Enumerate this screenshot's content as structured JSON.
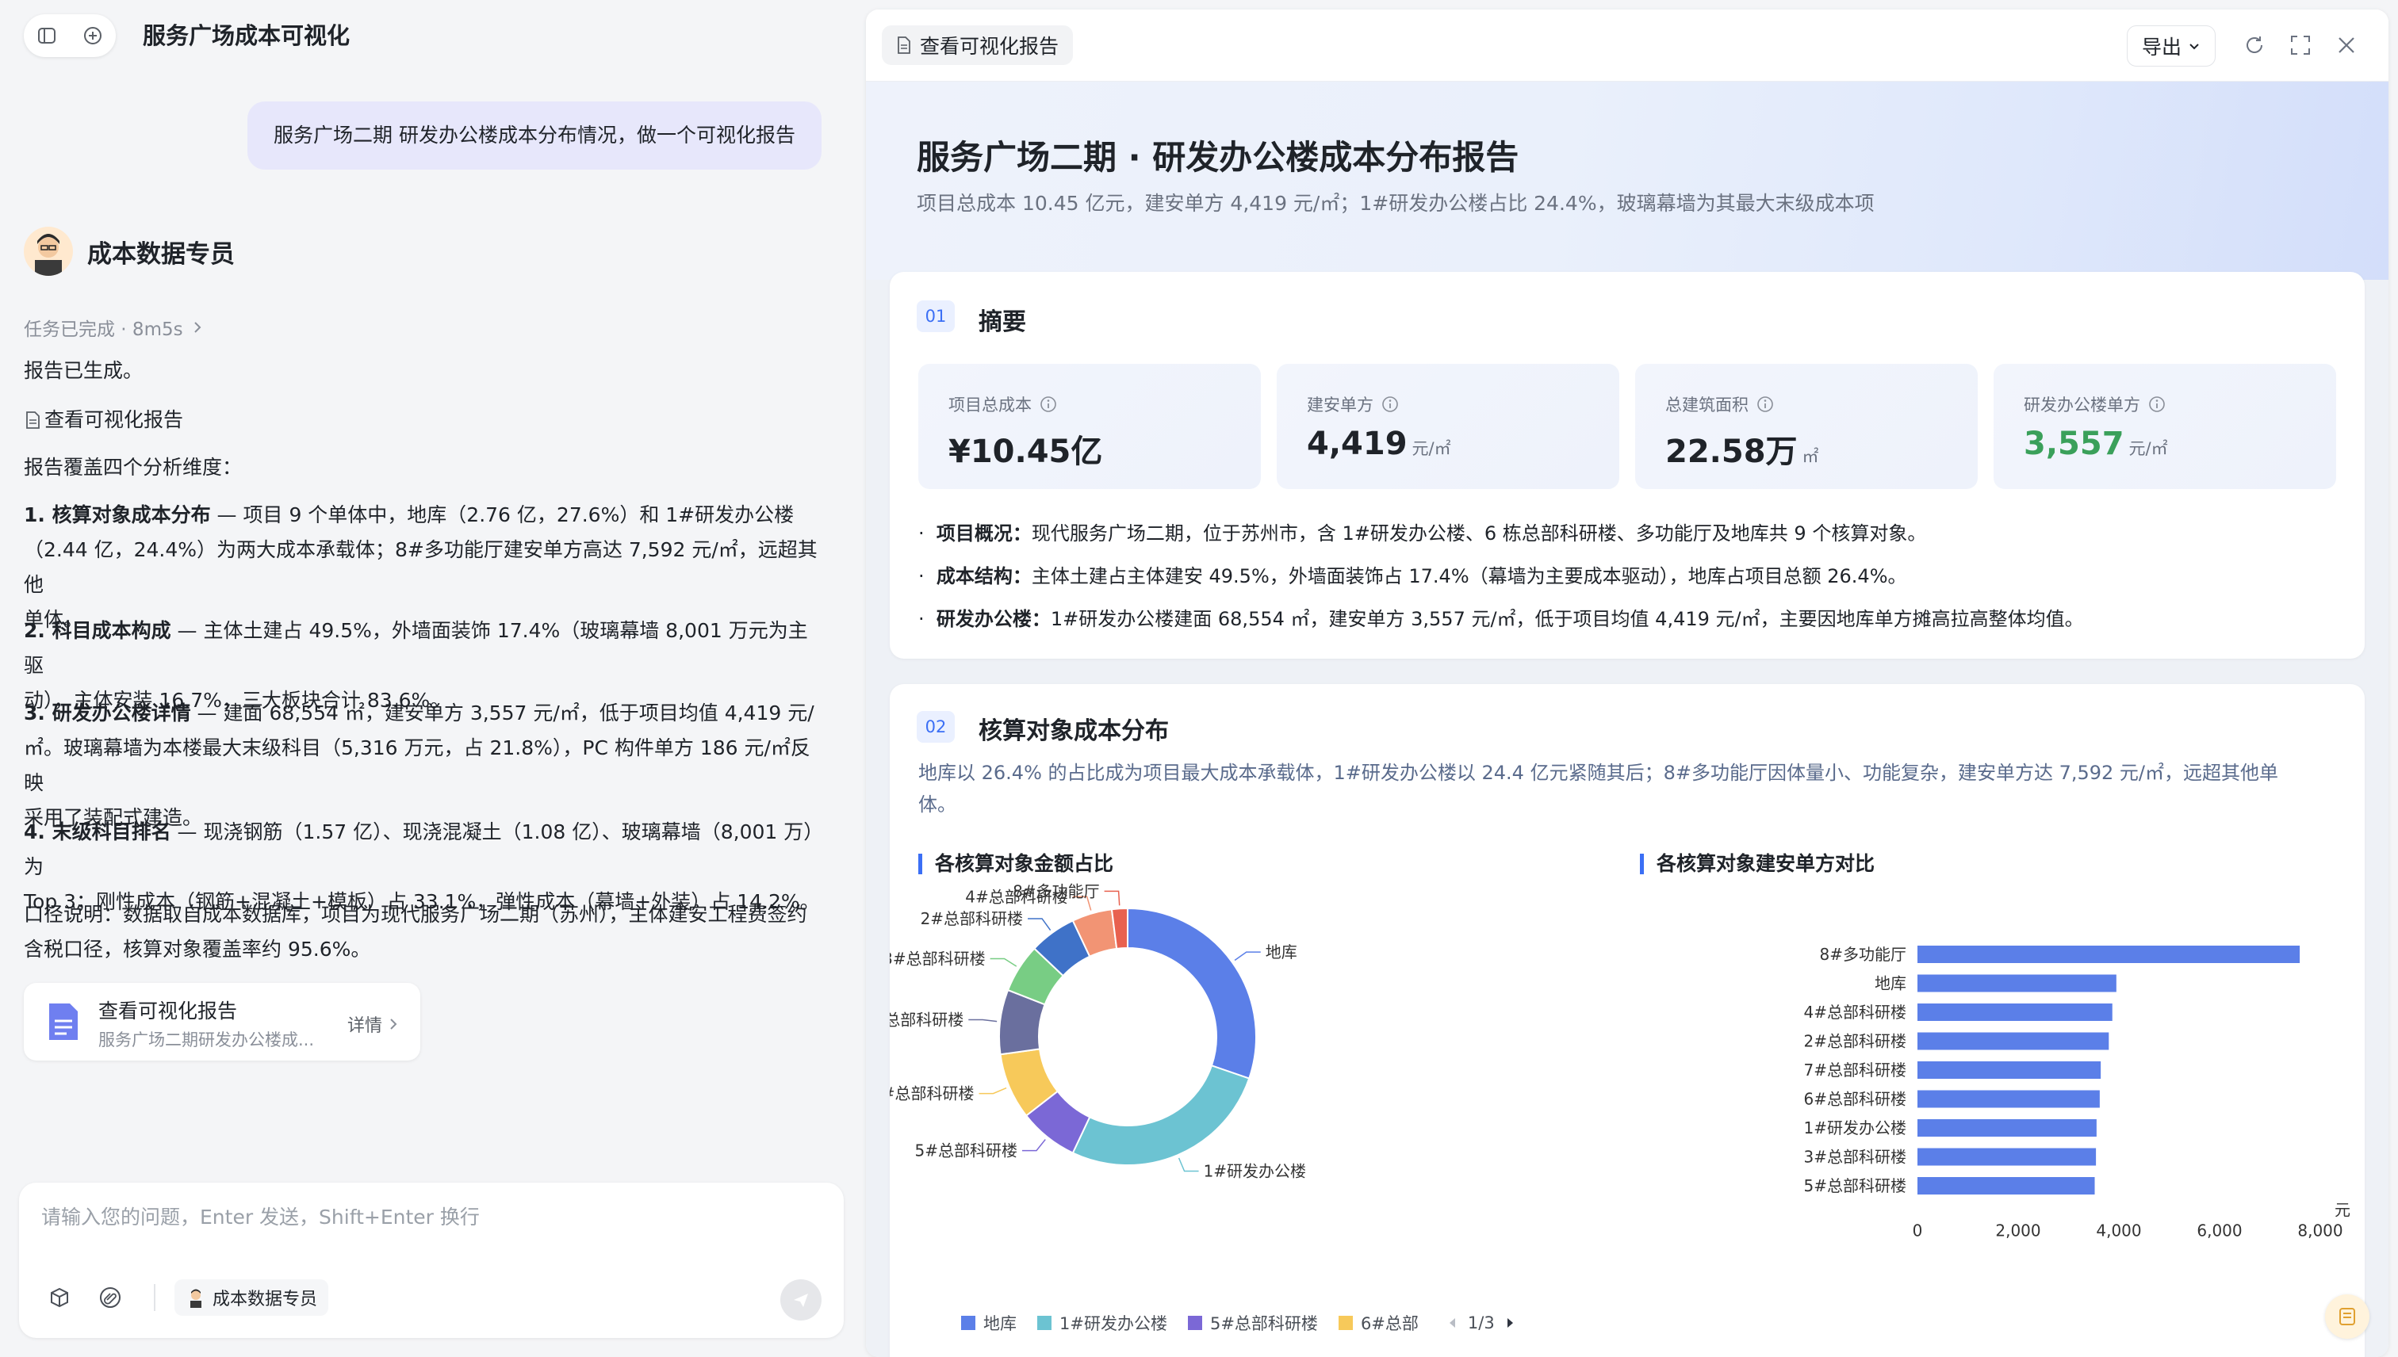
{
  "left": {
    "title": "服务广场成本可视化",
    "user_message": "服务广场二期  研发办公楼成本分布情况，做一个可视化报告",
    "agent_name": "成本数据专员",
    "status": "任务已完成 · 8m5s",
    "line1": "报告已生成。",
    "report_link": "查看可视化报告",
    "line_cover": "报告覆盖四个分析维度：",
    "p1_head": "1. 核算对象成本分布",
    "p1_text_a": " — 项目 9 个单体中，地库（2.76 亿，27.6%）和 1#研发办公楼",
    "p1_text_b": "（2.44 亿，24.4%）为两大成本承载体；8#多功能厅建安单方高达 7,592 元/㎡，远超其他",
    "p1_text_c": "单体。",
    "p2_head": "2. 科目成本构成",
    "p2_text_a": " — 主体土建占 49.5%，外墙面装饰 17.4%（玻璃幕墙 8,001 万元为主驱",
    "p2_text_b": "动），主体安装 16.7%，三大板块合计 83.6%。",
    "p3_head": "3. 研发办公楼详情",
    "p3_text_a": " — 建面 68,554 ㎡，建安单方 3,557 元/㎡，低于项目均值 4,419 元/",
    "p3_text_b": "㎡。玻璃幕墙为本楼最大末级科目（5,316 万元，占 21.8%），PC 构件单方 186 元/㎡反映",
    "p3_text_c": "采用了装配式建造。",
    "p4_head": "4. 末级科目排名",
    "p4_text_a": " — 现浇钢筋（1.57 亿）、现浇混凝土（1.08 亿）、玻璃幕墙（8,001 万）为",
    "p4_text_b": "Top 3；刚性成本（钢筋+混凝土+模板）占 33.1%，弹性成本（幕墙+外装）占 14.2%。",
    "note_a": "口径说明：数据取自成本数据库，项目为现代服务广场二期（苏州），主体建安工程费签约",
    "note_b": "含税口径，核算对象覆盖率约 95.6%。",
    "card_title": "查看可视化报告",
    "card_sub": "服务广场二期研发办公楼成...",
    "card_detail": "详情",
    "input_placeholder": "请输入您的问题，Enter 发送，Shift+Enter 换行",
    "agent_chip": "成本数据专员"
  },
  "right": {
    "tab": "查看可视化报告",
    "export": "导出",
    "hero_title": "服务广场二期 · 研发办公楼成本分布报告",
    "hero_sub": "项目总成本 10.45 亿元，建安单方 4,419 元/㎡；1#研发办公楼占比 24.4%，玻璃幕墙为其最大末级成本项",
    "s1_num": "01",
    "s1_title": "摘要",
    "kpis": [
      {
        "label": "项目总成本",
        "value": "¥10.45亿",
        "unit": ""
      },
      {
        "label": "建安单方",
        "value": "4,419",
        "unit": "元/㎡"
      },
      {
        "label": "总建筑面积",
        "value": "22.58万",
        "unit": "㎡"
      },
      {
        "label": "研发办公楼单方",
        "value": "3,557",
        "unit": "元/㎡"
      }
    ],
    "kpi_highlight_color": "#3aa05a",
    "b1_head": "项目概况：",
    "b1_text": "现代服务广场二期，位于苏州市，含 1#研发办公楼、6 栋总部科研楼、多功能厅及地库共 9 个核算对象。",
    "b2_head": "成本结构：",
    "b2_text": "主体土建占主体建安 49.5%，外墙面装饰占 17.4%（幕墙为主要成本驱动），地库占项目总额 26.4%。",
    "b3_head": "研发办公楼：",
    "b3_text": "1#研发办公楼建面 68,554 ㎡，建安单方 3,557 元/㎡，低于项目均值 4,419 元/㎡，主要因地库单方摊高拉高整体均值。",
    "s2_num": "02",
    "s2_title": "核算对象成本分布",
    "s2_desc_a": "地库以 26.4% 的占比成为项目最大成本承载体，1#研发办公楼以 24.4 亿元紧随其后；8#多功能厅因体量小、功能复杂，建安单方达 7,592 元/㎡，远超其他单",
    "s2_desc_b": "体。",
    "pie_title": "各核算对象金额占比",
    "bar_title": "各核算对象建安单方对比",
    "legend_page": "1/3"
  },
  "chart_data": [
    {
      "type": "pie",
      "variant": "donut",
      "title": "各核算对象金额占比",
      "categories": [
        "地库",
        "1#研发办公楼",
        "5#总部科研楼",
        "6#总部科研楼",
        "7#总部科研楼",
        "3#总部科研楼",
        "2#总部科研楼",
        "4#总部科研楼",
        "8#多功能厅"
      ],
      "values": [
        27.6,
        24.4,
        6.8,
        7.6,
        7.4,
        5.6,
        5.4,
        4.6,
        1.8
      ],
      "colors": [
        "#5b7fe8",
        "#6cc3d2",
        "#7b68d6",
        "#f7c95a",
        "#6a6f9e",
        "#78cd84",
        "#3f72c8",
        "#f29474",
        "#e8614f"
      ],
      "legend_visible": [
        "地库",
        "1#研发办公楼",
        "5#总部科研楼",
        "6#总部"
      ]
    },
    {
      "type": "bar",
      "orientation": "horizontal",
      "title": "各核算对象建安单方对比",
      "categories": [
        "8#多功能厅",
        "地库",
        "4#总部科研楼",
        "2#总部科研楼",
        "7#总部科研楼",
        "6#总部科研楼",
        "1#研发办公楼",
        "3#总部科研楼",
        "5#总部科研楼"
      ],
      "values": [
        7592,
        3950,
        3870,
        3800,
        3640,
        3620,
        3557,
        3545,
        3520
      ],
      "xlim": [
        0,
        8000
      ],
      "xticks": [
        "0",
        "2,000",
        "4,000",
        "6,000",
        "8,000"
      ],
      "unit": "元",
      "color": "#5b7fe8"
    }
  ]
}
